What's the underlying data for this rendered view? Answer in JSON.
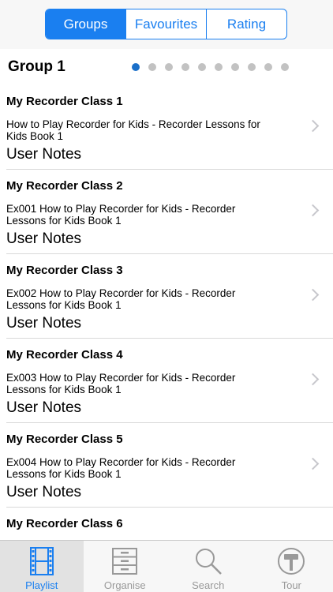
{
  "segments": [
    {
      "label": "Groups",
      "active": true
    },
    {
      "label": "Favourites",
      "active": false
    },
    {
      "label": "Rating",
      "active": false
    }
  ],
  "group": {
    "title": "Group 1",
    "page_count": 10,
    "current_page": 1
  },
  "rows": [
    {
      "title": "My Recorder Class 1",
      "desc": "How to Play Recorder for Kids - Recorder Lessons for Kids Book 1",
      "notes": "User Notes"
    },
    {
      "title": "My Recorder Class 2",
      "desc": "Ex001 How to Play Recorder for Kids - Recorder Lessons for Kids Book 1",
      "notes": "User Notes"
    },
    {
      "title": "My Recorder Class 3",
      "desc": "Ex002 How to Play Recorder for Kids - Recorder Lessons for Kids Book 1",
      "notes": "User Notes"
    },
    {
      "title": "My Recorder Class 4",
      "desc": "Ex003 How to Play Recorder for Kids - Recorder Lessons for Kids Book 1",
      "notes": "User Notes"
    },
    {
      "title": "My Recorder Class 5",
      "desc": "Ex004 How to Play Recorder for Kids - Recorder Lessons for Kids Book 1",
      "notes": "User Notes"
    },
    {
      "title": "My Recorder Class 6",
      "desc": "",
      "notes": ""
    }
  ],
  "tabs": [
    {
      "label": "Playlist",
      "icon": "film-icon",
      "active": true
    },
    {
      "label": "Organise",
      "icon": "cabinet-icon",
      "active": false
    },
    {
      "label": "Search",
      "icon": "magnifier-icon",
      "active": false
    },
    {
      "label": "Tour",
      "icon": "signpost-icon",
      "active": false
    }
  ],
  "colors": {
    "accent": "#1a7ff0",
    "dot_active": "#1a6fc9",
    "dot_inactive": "#c2c2c2"
  }
}
